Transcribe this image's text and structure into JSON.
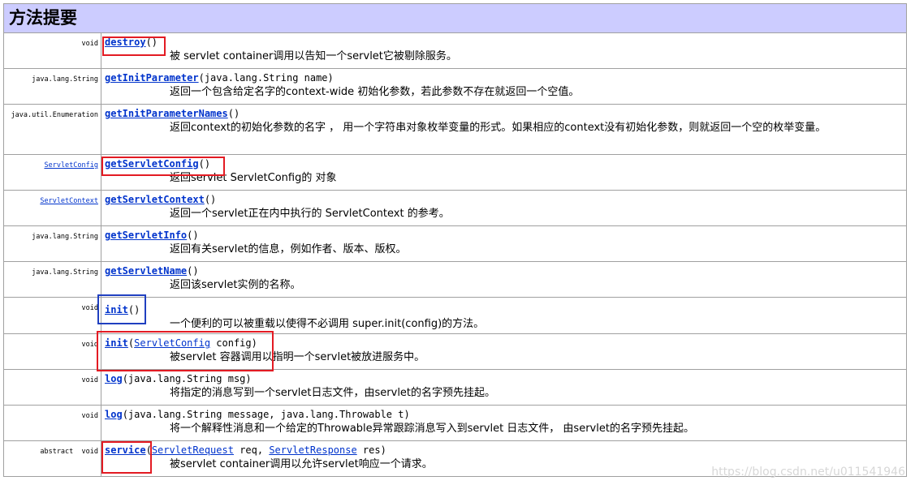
{
  "header": {
    "title": "方法提要"
  },
  "rows": [
    {
      "type": "void",
      "name": "destroy",
      "params": "()",
      "desc": "被 servlet container调用以告知一个servlet它被剔除服务。"
    },
    {
      "type": "java.lang.String",
      "name": "getInitParameter",
      "params": "(java.lang.String name)",
      "desc": "返回一个包含给定名字的context-wide 初始化参数，若此参数不存在就返回一个空值。"
    },
    {
      "type": "java.util.Enumeration",
      "name": "getInitParameterNames",
      "params": "()",
      "desc": "返回context的初始化参数的名字 ， 用一个字符串对象枚举变量的形式。如果相应的context没有初始化参数，则就返回一个空的枚举变量。"
    },
    {
      "type": "ServletConfig",
      "name": "getServletConfig",
      "params": "()",
      "desc": "返回servlet ServletConfig的 对象"
    },
    {
      "type": "ServletContext",
      "name": "getServletContext",
      "params": "()",
      "desc": "返回一个servlet正在内中执行的 ServletContext 的参考。"
    },
    {
      "type": "java.lang.String",
      "name": "getServletInfo",
      "params": "()",
      "desc": "返回有关servlet的信息，例如作者、版本、版权。"
    },
    {
      "type": "java.lang.String",
      "name": "getServletName",
      "params": "()",
      "desc": "返回该servlet实例的名称。"
    },
    {
      "type": "void",
      "name": "init",
      "params": "()",
      "desc": "一个便利的可以被重载以使得不必调用 super.init(config)的方法。"
    },
    {
      "type": "void",
      "name": "init",
      "open": "(",
      "param_type": "ServletConfig",
      "rest": " config)",
      "desc": "被servlet 容器调用以指明一个servlet被放进服务中。"
    },
    {
      "type": "void",
      "name": "log",
      "params": "(java.lang.String msg)",
      "desc": "将指定的消息写到一个servlet日志文件，由servlet的名字预先挂起。"
    },
    {
      "type": "void",
      "name": "log",
      "params": "(java.lang.String message, java.lang.Throwable t)",
      "desc": "将一个解释性消息和一个给定的Throwable异常跟踪消息写入到servlet 日志文件， 由servlet的名字预先挂起。"
    },
    {
      "type": "abstract  void",
      "name": "service",
      "open": "(",
      "param_type": "ServletRequest",
      "mid": " req, ",
      "param_type2": "ServletResponse",
      "rest": " res)",
      "desc": "被servlet container调用以允许servlet响应一个请求。"
    }
  ],
  "watermark": "https://blog.csdn.net/u011541946",
  "colors": {
    "header_bg": "#ccccff",
    "link": "#0033cc",
    "highlight_red": "#e31b23",
    "highlight_blue": "#2040c0"
  }
}
